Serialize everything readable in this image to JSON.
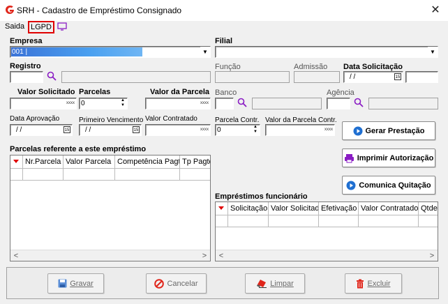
{
  "window": {
    "title": "SRH - Cadastro de Empréstimo Consignado",
    "close_glyph": "✕"
  },
  "menu": {
    "items": [
      "Saida",
      "LGPD"
    ],
    "highlight_color": "#e00000"
  },
  "form": {
    "empresa_label": "Empresa",
    "empresa_value": "001 |",
    "filial_label": "Filial",
    "registro_label": "Registro",
    "funcao_label": "Função",
    "admissao_label": "Admissão",
    "data_solicitacao_label": "Data Solicitação",
    "data_solicitacao_value": "/ /",
    "valor_solicitado_label": "Valor Solicitado",
    "parcelas_label": "Parcelas",
    "parcelas_value": "0",
    "valor_parcela_label": "Valor da Parcela",
    "banco_label": "Banco",
    "agencia_label": "Agência",
    "data_aprovacao_label": "Data Aprovação",
    "data_aprovacao_value": "/ /",
    "primeiro_vencimento_label": "Primeiro Vencimento",
    "primeiro_vencimento_value": "/ /",
    "valor_contratado_label": "Valor Contratado",
    "parcela_contr_label": "Parcela Contr.",
    "parcela_contr_value": "0",
    "valor_parcela_contr_label": "Valor da Parcela Contr.",
    "money_mask": "xxxx"
  },
  "actions": {
    "gerar_prestacao": "Gerar Prestação",
    "imprimir_autorizacao": "Imprimir Autorização",
    "comunica_quitacao": "Comunica Quitação",
    "accent_color": "#1f6fd1"
  },
  "parcelas_grid": {
    "title": "Parcelas referente a este empréstimo",
    "columns": [
      "Nr.Parcela",
      "Valor Parcela",
      "Competência Pagto",
      "Tp Pagto"
    ]
  },
  "emprestimos_grid": {
    "title": "Empréstimos funcionário",
    "columns": [
      "Solicitação",
      "Valor Solicitado",
      "Efetivação",
      "Valor Contratado",
      "Qtde"
    ]
  },
  "footer": {
    "gravar": "Gravar",
    "cancelar": "Cancelar",
    "limpar": "Limpar",
    "excluir": "Excluir"
  },
  "scroll": {
    "left": "<",
    "right": ">"
  }
}
